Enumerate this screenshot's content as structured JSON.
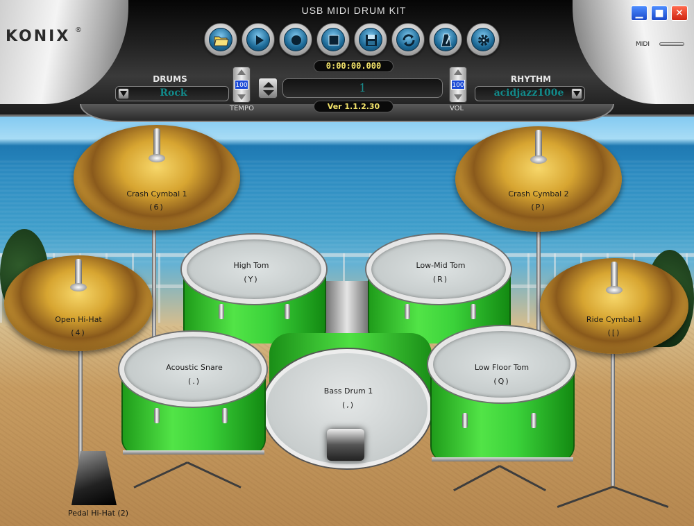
{
  "window": {
    "title": "USB MIDI DRUM KIT",
    "brand": "KONIX",
    "brand_mark": "®",
    "controls": {
      "minimize": "▁",
      "maximize": "■",
      "close": "✕"
    },
    "midi_label": "MIDI"
  },
  "toolbar": {
    "buttons": [
      {
        "name": "open",
        "icon": "folder-icon"
      },
      {
        "name": "play",
        "icon": "play-icon"
      },
      {
        "name": "record",
        "icon": "record-icon"
      },
      {
        "name": "stop",
        "icon": "stop-icon"
      },
      {
        "name": "save",
        "icon": "save-icon"
      },
      {
        "name": "loop",
        "icon": "loop-icon"
      },
      {
        "name": "metronome",
        "icon": "metronome-icon"
      },
      {
        "name": "settings",
        "icon": "gear-icon"
      }
    ]
  },
  "transport": {
    "time": "0:00:00.000",
    "counter": "1",
    "version": "Ver 1.1.2.30"
  },
  "drums": {
    "label": "DRUMS",
    "value": "Rock"
  },
  "rhythm": {
    "label": "RHYTHM",
    "value": "acidjazz100e"
  },
  "tempo": {
    "label": "TEMPO",
    "value": "100"
  },
  "volume": {
    "label": "VOL",
    "value": "100"
  },
  "kit": {
    "crash1": {
      "name": "Crash Cymbal 1",
      "key": "(6)"
    },
    "crash2": {
      "name": "Crash Cymbal 2",
      "key": "(P)"
    },
    "hihat": {
      "name": "Open Hi-Hat",
      "key": "(4)"
    },
    "ride": {
      "name": "Ride Cymbal 1",
      "key": "([)"
    },
    "high_tom": {
      "name": "High Tom",
      "key": "(Y)"
    },
    "low_mid_tom": {
      "name": "Low-Mid Tom",
      "key": "(R)"
    },
    "snare": {
      "name": "Acoustic Snare",
      "key": "(.)"
    },
    "floor_tom": {
      "name": "Low Floor Tom",
      "key": "(Q)"
    },
    "bass": {
      "name": "Bass Drum 1",
      "key": "(,)"
    },
    "pedal_hihat": {
      "name": "Pedal Hi-Hat",
      "key": "(2)"
    }
  },
  "colors": {
    "accent_teal": "#128a8a",
    "readout_yellow": "#f3e36a",
    "shell_green": "#3bd23a",
    "cymbal_gold": "#d7a531"
  }
}
